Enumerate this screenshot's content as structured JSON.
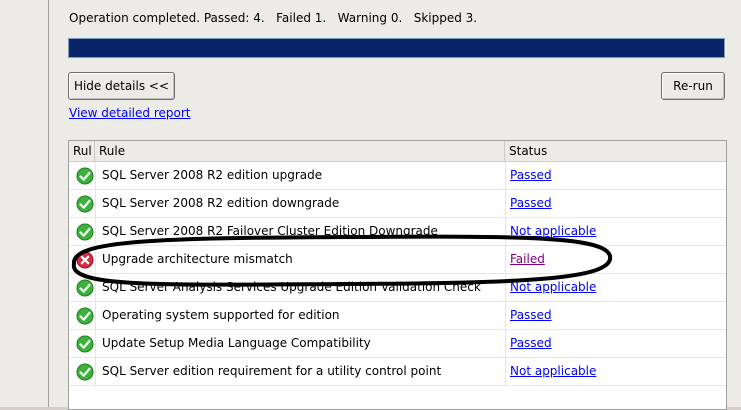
{
  "summary": "Operation completed. Passed: 4.   Failed 1.   Warning 0.   Skipped 3.",
  "progress_fraction": 1.0,
  "buttons": {
    "hide_details": "Hide details <<",
    "rerun": "Re-run"
  },
  "report_link": "View detailed report",
  "table": {
    "headers": [
      "Rul",
      "Rule",
      "Status"
    ],
    "rows": [
      {
        "rule": "SQL Server 2008 R2 edition upgrade",
        "status": "Passed",
        "icon": "check-icon"
      },
      {
        "rule": "SQL Server 2008 R2 edition downgrade",
        "status": "Passed",
        "icon": "check-icon"
      },
      {
        "rule": "SQL Server 2008 R2 Failover Cluster Edition Downgrade",
        "status": "Not applicable",
        "icon": "check-icon"
      },
      {
        "rule": "Upgrade architecture mismatch",
        "status": "Failed",
        "icon": "error-icon"
      },
      {
        "rule": "SQL Server Analysis Services Upgrade Edition Validation Check",
        "status": "Not applicable",
        "icon": "check-icon"
      },
      {
        "rule": "Operating system supported for edition",
        "status": "Passed",
        "icon": "check-icon"
      },
      {
        "rule": "Update Setup Media Language Compatibility",
        "status": "Passed",
        "icon": "check-icon"
      },
      {
        "rule": "SQL Server edition requirement for a utility control point",
        "status": "Not applicable",
        "icon": "check-icon"
      }
    ]
  },
  "colors": {
    "progress": "#0a246a",
    "link": "#0000ff",
    "visited_link": "#800080",
    "pass": "#2e9e2e",
    "fail": "#d0203a"
  }
}
